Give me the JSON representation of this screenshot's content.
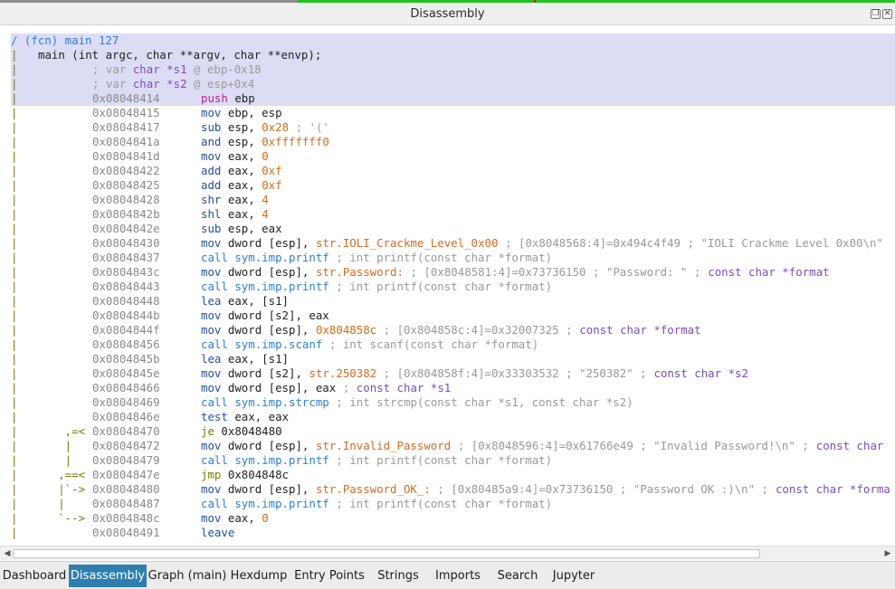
{
  "window": {
    "title": "Disassembly"
  },
  "function": {
    "header": "/ (fcn) main 127",
    "signature": "main (int argc, char **argv, char **envp);",
    "vars": [
      {
        "prefix": "; var ",
        "type": "char *",
        "name": "s1",
        "loc": " @ ebp-0x18"
      },
      {
        "prefix": "; var ",
        "type": "char *",
        "name": "s2",
        "loc": " @ esp+0x4"
      }
    ]
  },
  "instructions": [
    {
      "gutter": "|",
      "addr": "0x08048414",
      "mn": "push",
      "ops": " ebp",
      "comment": "",
      "highlight": true
    },
    {
      "gutter": "|",
      "addr": "0x08048415",
      "mn": "mov",
      "ops": " ebp, esp",
      "comment": ""
    },
    {
      "gutter": "|",
      "addr": "0x08048417",
      "mn": "sub",
      "ops": " esp, ",
      "imm": "0x28",
      "comment": " ; '('"
    },
    {
      "gutter": "|",
      "addr": "0x0804841a",
      "mn": "and",
      "ops": " esp, ",
      "imm": "0xfffffff0",
      "comment": ""
    },
    {
      "gutter": "|",
      "addr": "0x0804841d",
      "mn": "mov",
      "ops": " eax, ",
      "imm": "0",
      "comment": ""
    },
    {
      "gutter": "|",
      "addr": "0x08048422",
      "mn": "add",
      "ops": " eax, ",
      "imm": "0xf",
      "comment": ""
    },
    {
      "gutter": "|",
      "addr": "0x08048425",
      "mn": "add",
      "ops": " eax, ",
      "imm": "0xf",
      "comment": ""
    },
    {
      "gutter": "|",
      "addr": "0x08048428",
      "mn": "shr",
      "ops": " eax, ",
      "imm": "4",
      "comment": ""
    },
    {
      "gutter": "|",
      "addr": "0x0804842b",
      "mn": "shl",
      "ops": " eax, ",
      "imm": "4",
      "comment": ""
    },
    {
      "gutter": "|",
      "addr": "0x0804842e",
      "mn": "sub",
      "ops": " esp, eax",
      "comment": ""
    },
    {
      "gutter": "|",
      "addr": "0x08048430",
      "mn": "mov",
      "ops": " dword [esp], ",
      "sym": "str.IOLI_Crackme_Level_0x00",
      "comment": " ; [0x8048568:4]=0x494c4f49 ; \"IOLI Crackme Level 0x00\\n\""
    },
    {
      "gutter": "|",
      "addr": "0x08048437",
      "mn": "call",
      "ops": " sym.imp.printf",
      "comment": " ; int printf(const char *format)",
      "isCall": true
    },
    {
      "gutter": "|",
      "addr": "0x0804843c",
      "mn": "mov",
      "ops": " dword [esp], ",
      "sym": "str.Password:",
      "comment": " ; [0x8048581:4]=0x73736150 ; \"Password: \" ; ",
      "typ": "const char *format"
    },
    {
      "gutter": "|",
      "addr": "0x08048443",
      "mn": "call",
      "ops": " sym.imp.printf",
      "comment": " ; int printf(const char *format)",
      "isCall": true
    },
    {
      "gutter": "|",
      "addr": "0x08048448",
      "mn": "lea",
      "ops": " eax, [s1]",
      "comment": ""
    },
    {
      "gutter": "|",
      "addr": "0x0804844b",
      "mn": "mov",
      "ops": " dword [s2], eax",
      "comment": ""
    },
    {
      "gutter": "|",
      "addr": "0x0804844f",
      "mn": "mov",
      "ops": " dword [esp], ",
      "imm": "0x804858c",
      "comment": " ; [0x804858c:4]=0x32007325 ; ",
      "typ": "const char *format"
    },
    {
      "gutter": "|",
      "addr": "0x08048456",
      "mn": "call",
      "ops": " sym.imp.scanf",
      "comment": " ; int scanf(const char *format)",
      "isCall": true
    },
    {
      "gutter": "|",
      "addr": "0x0804845b",
      "mn": "lea",
      "ops": " eax, [s1]",
      "comment": ""
    },
    {
      "gutter": "|",
      "addr": "0x0804845e",
      "mn": "mov",
      "ops": " dword [s2], ",
      "sym": "str.250382",
      "comment": " ; [0x804858f:4]=0x33303532 ; \"250382\" ; ",
      "typ": "const char *s2"
    },
    {
      "gutter": "|",
      "addr": "0x08048466",
      "mn": "mov",
      "ops": " dword [esp], eax",
      "comment": " ; ",
      "typ": "const char *s1"
    },
    {
      "gutter": "|",
      "addr": "0x08048469",
      "mn": "call",
      "ops": " sym.imp.strcmp",
      "comment": " ; int strcmp(const char *s1, const char *s2)",
      "isCall": true
    },
    {
      "gutter": "|",
      "addr": "0x0804846e",
      "mn": "test",
      "ops": " eax, eax",
      "comment": ""
    },
    {
      "gutter": "|       ,=<",
      "addr": "0x08048470",
      "mn": "je",
      "ops": " 0x8048480",
      "comment": "",
      "isCond": true
    },
    {
      "gutter": "|       |",
      "addr": "0x08048472",
      "mn": "mov",
      "ops": " dword [esp], ",
      "sym": "str.Invalid_Password",
      "comment": " ; [0x8048596:4]=0x61766e49 ; \"Invalid Password!\\n\" ; ",
      "typ": "const char"
    },
    {
      "gutter": "|       |",
      "addr": "0x08048479",
      "mn": "call",
      "ops": " sym.imp.printf",
      "comment": " ; int printf(const char *format)",
      "isCall": true
    },
    {
      "gutter": "|      ,==<",
      "addr": "0x0804847e",
      "mn": "jmp",
      "ops": " 0x804848c",
      "comment": "",
      "isCond": true
    },
    {
      "gutter": "|      |`->",
      "addr": "0x08048480",
      "mn": "mov",
      "ops": " dword [esp], ",
      "sym": "str.Password_OK_:",
      "comment": " ; [0x80485a9:4]=0x73736150 ; \"Password OK :)\\n\" ; ",
      "typ": "const char *forma"
    },
    {
      "gutter": "|      |",
      "addr": "0x08048487",
      "mn": "call",
      "ops": " sym.imp.printf",
      "comment": " ; int printf(const char *format)",
      "isCall": true
    },
    {
      "gutter": "|      `-->",
      "addr": "0x0804848c",
      "mn": "mov",
      "ops": " eax, ",
      "imm": "0",
      "comment": ""
    },
    {
      "gutter": "|",
      "addr": "0x08048491",
      "mn": "leave",
      "ops": "",
      "comment": ""
    }
  ],
  "tabs": [
    {
      "label": "Dashboard",
      "active": false
    },
    {
      "label": "Disassembly",
      "active": true
    },
    {
      "label": "Graph (main)",
      "active": false
    },
    {
      "label": "Hexdump",
      "active": false
    },
    {
      "label": "Entry Points",
      "active": false
    },
    {
      "label": "Strings",
      "active": false
    },
    {
      "label": "Imports",
      "active": false
    },
    {
      "label": "Search",
      "active": false
    },
    {
      "label": "Jupyter",
      "active": false
    }
  ],
  "colors": {
    "accent_tab": "#2e7fb0",
    "highlight_row": "#dcdcf5",
    "progress_green": "#23c223"
  }
}
